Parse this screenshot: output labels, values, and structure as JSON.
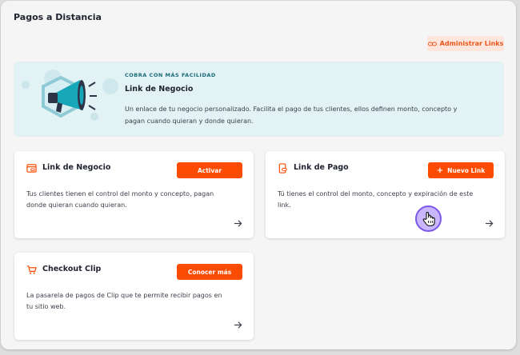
{
  "page": {
    "title": "Pagos a Distancia",
    "manage_links_label": "Administrar Links"
  },
  "banner": {
    "eyebrow": "COBRA CON MÁS FACILIDAD",
    "title": "Link de Negocio",
    "description_line1": "Un enlace de tu negocio personalizado. Facilita el pago de tus clientes, ellos definen monto, concepto y",
    "description_line2": "pagan cuando quieran y donde quieran."
  },
  "cards": {
    "business_link": {
      "title": "Link de Negocio",
      "button_label": "Activar",
      "desc_line1": "Tus clientes tienen el control del monto y concepto, pagan",
      "desc_line2": "donde quieran cuando quieran."
    },
    "payment_link": {
      "title": "Link de Pago",
      "button_label": "Nuevo Link",
      "button_prefix": "+",
      "desc_line1": "Tú tienes el control del monto, concepto y expiración de este",
      "desc_line2": "link."
    },
    "checkout": {
      "title": "Checkout Clip",
      "button_label": "Conocer más",
      "desc_line1": "La pasarela de pagos de Clip que te permite recibir pagos en",
      "desc_line2": "tu sitio web."
    }
  },
  "colors": {
    "accent": "#fc4c02",
    "banner_bg": "#e2f2f5",
    "teal": "#1a6b78",
    "cursor_highlight": "#7b57e8"
  },
  "icons": [
    "link-icon",
    "megaphone-illustration",
    "storefront-link-icon",
    "phone-link-icon",
    "cart-icon",
    "arrow-right-icon",
    "hand-cursor-icon"
  ]
}
